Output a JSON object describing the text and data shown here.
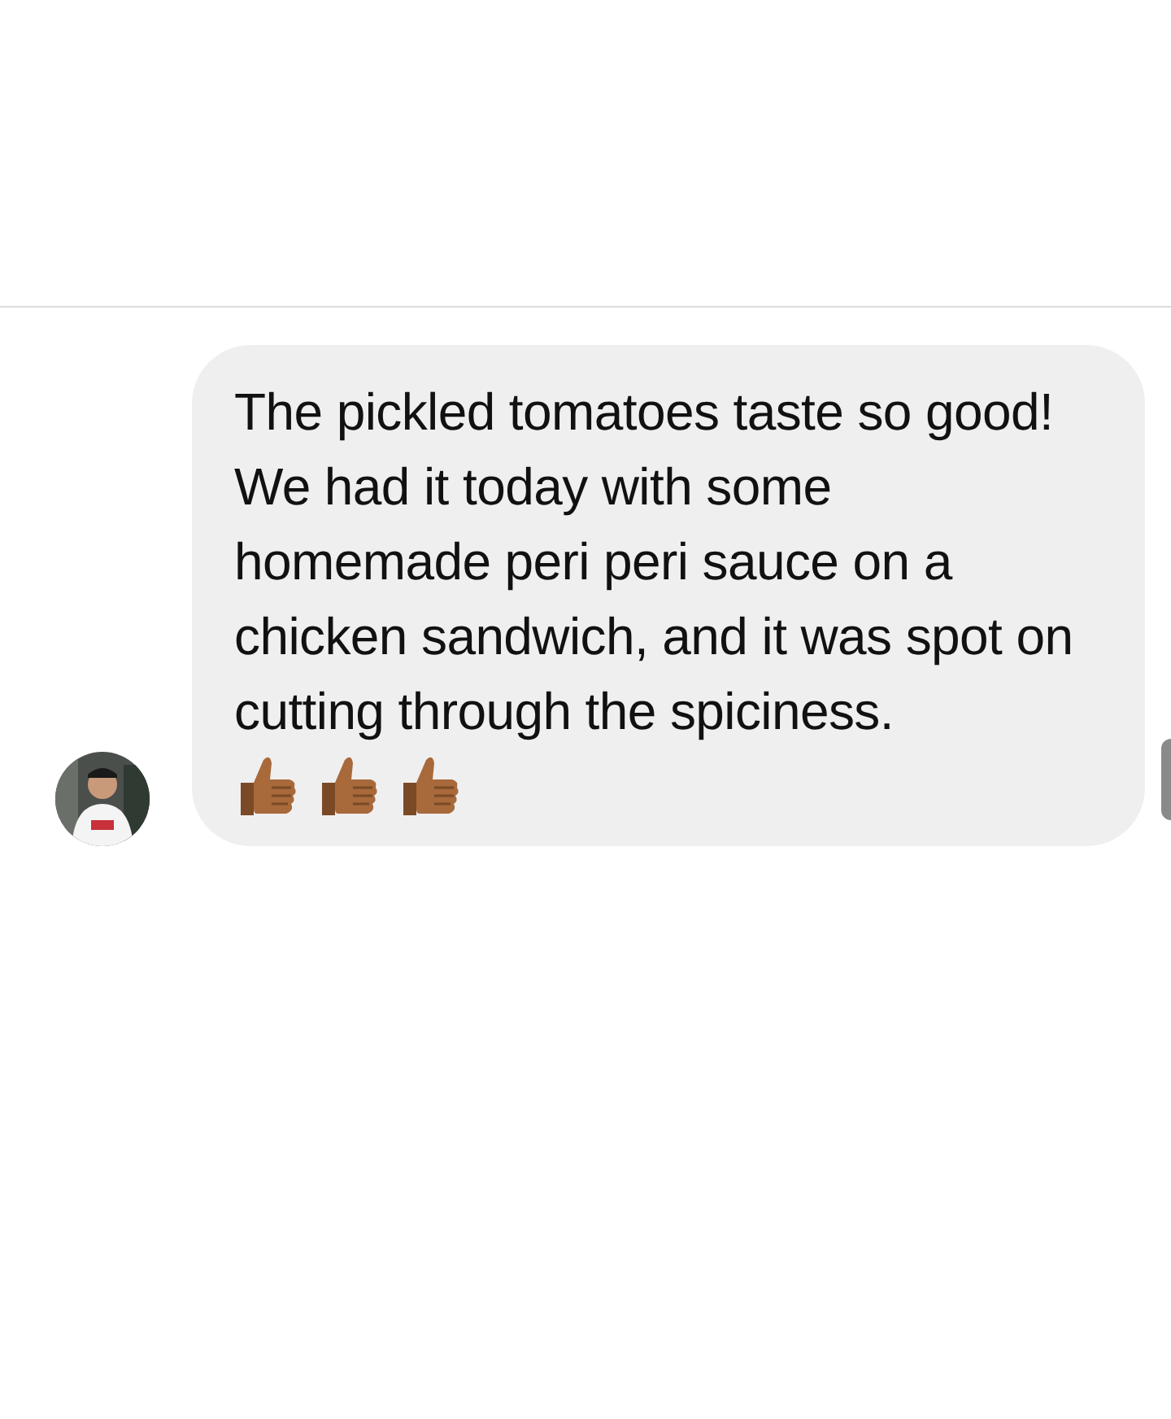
{
  "message": {
    "paragraphs": [
      "The pickled tomatoes taste so good!",
      "We had it today with some homemade peri peri sauce on a chicken sandwich, and it was spot on cutting through the spiciness."
    ],
    "emojis": [
      {
        "kind": "thumbs-up"
      },
      {
        "kind": "thumbs-up"
      },
      {
        "kind": "thumbs-up"
      }
    ]
  }
}
